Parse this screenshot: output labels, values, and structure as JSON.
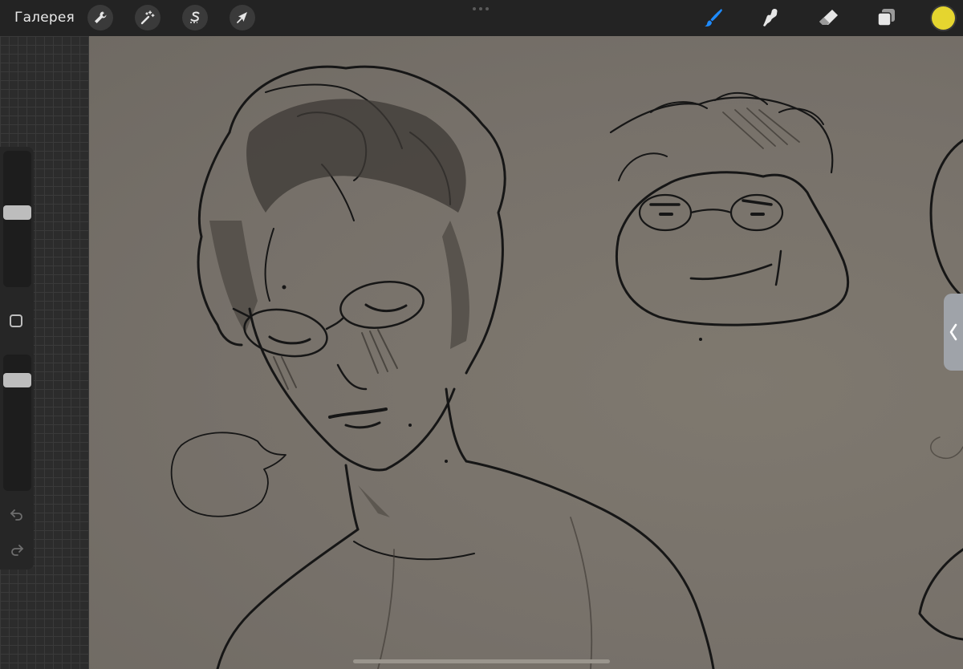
{
  "toolbar": {
    "gallery_label": "Галерея",
    "actions": [
      "wrench-icon",
      "magic-wand-icon",
      "selection-s-icon",
      "arrow-transform-icon"
    ],
    "tools": {
      "active": "brush",
      "items": [
        "brush-icon",
        "smudge-icon",
        "eraser-icon",
        "layers-icon"
      ]
    },
    "current_color": "#e5d52f",
    "accent_color": "#1e8bff"
  },
  "sidebar": {
    "brush_size": 0.55,
    "opacity": 0.85,
    "buttons": [
      "modify-square-icon",
      "undo-icon",
      "redo-icon"
    ]
  },
  "canvas": {
    "background_color": "#7d776c",
    "ink_color": "#161616"
  }
}
